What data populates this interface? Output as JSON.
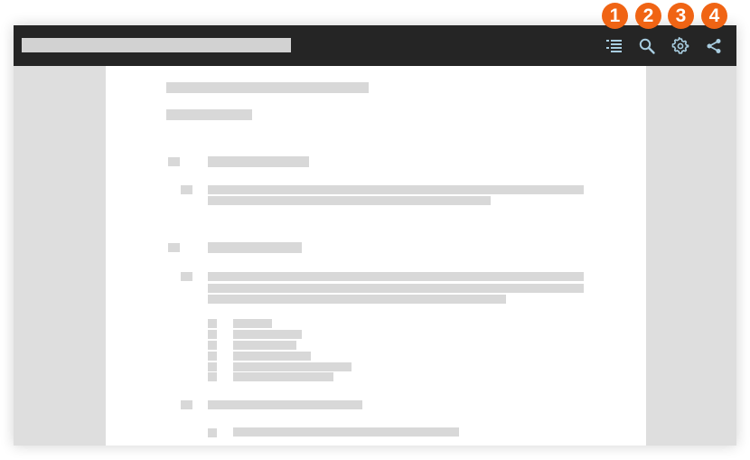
{
  "toolbar": {
    "buttons": [
      {
        "name": "table-of-contents",
        "icon": "list-icon"
      },
      {
        "name": "search",
        "icon": "search-icon"
      },
      {
        "name": "settings",
        "icon": "gear-icon"
      },
      {
        "name": "share",
        "icon": "share-icon"
      }
    ],
    "icon_color": "#a8cde0"
  },
  "badges": [
    "1",
    "2",
    "3",
    "4"
  ],
  "colors": {
    "topbar": "#252525",
    "placeholder": "#d8d8d8",
    "badge": "#f06414",
    "canvas": "#dedede"
  }
}
